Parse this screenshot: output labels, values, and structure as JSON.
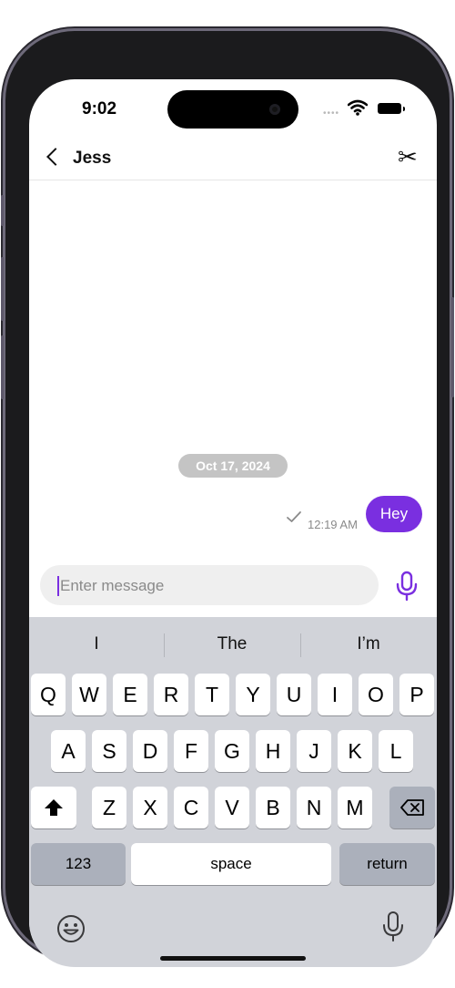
{
  "status": {
    "time": "9:02",
    "signal": "••••"
  },
  "nav": {
    "title": "Jess"
  },
  "chat": {
    "date": "Oct 17, 2024",
    "message": {
      "text": "Hey",
      "time": "12:19 AM"
    }
  },
  "composer": {
    "placeholder": "Enter message"
  },
  "keyboard": {
    "suggestions": [
      "I",
      "The",
      "I’m"
    ],
    "row1": [
      "Q",
      "W",
      "E",
      "R",
      "T",
      "Y",
      "U",
      "I",
      "O",
      "P"
    ],
    "row2": [
      "A",
      "S",
      "D",
      "F",
      "G",
      "H",
      "J",
      "K",
      "L"
    ],
    "row3": [
      "Z",
      "X",
      "C",
      "V",
      "B",
      "N",
      "M"
    ],
    "numbers_label": "123",
    "space_label": "space",
    "return_label": "return"
  },
  "colors": {
    "accent": "#7a2fe0",
    "keyboard_bg": "#d1d3d9",
    "date_pill": "#c4c4c4"
  },
  "icons": [
    "back-icon",
    "scissors-icon",
    "wifi-icon",
    "battery-icon",
    "checkmark-icon",
    "microphone-icon",
    "shift-icon",
    "backspace-icon",
    "emoji-icon",
    "dictation-icon"
  ]
}
